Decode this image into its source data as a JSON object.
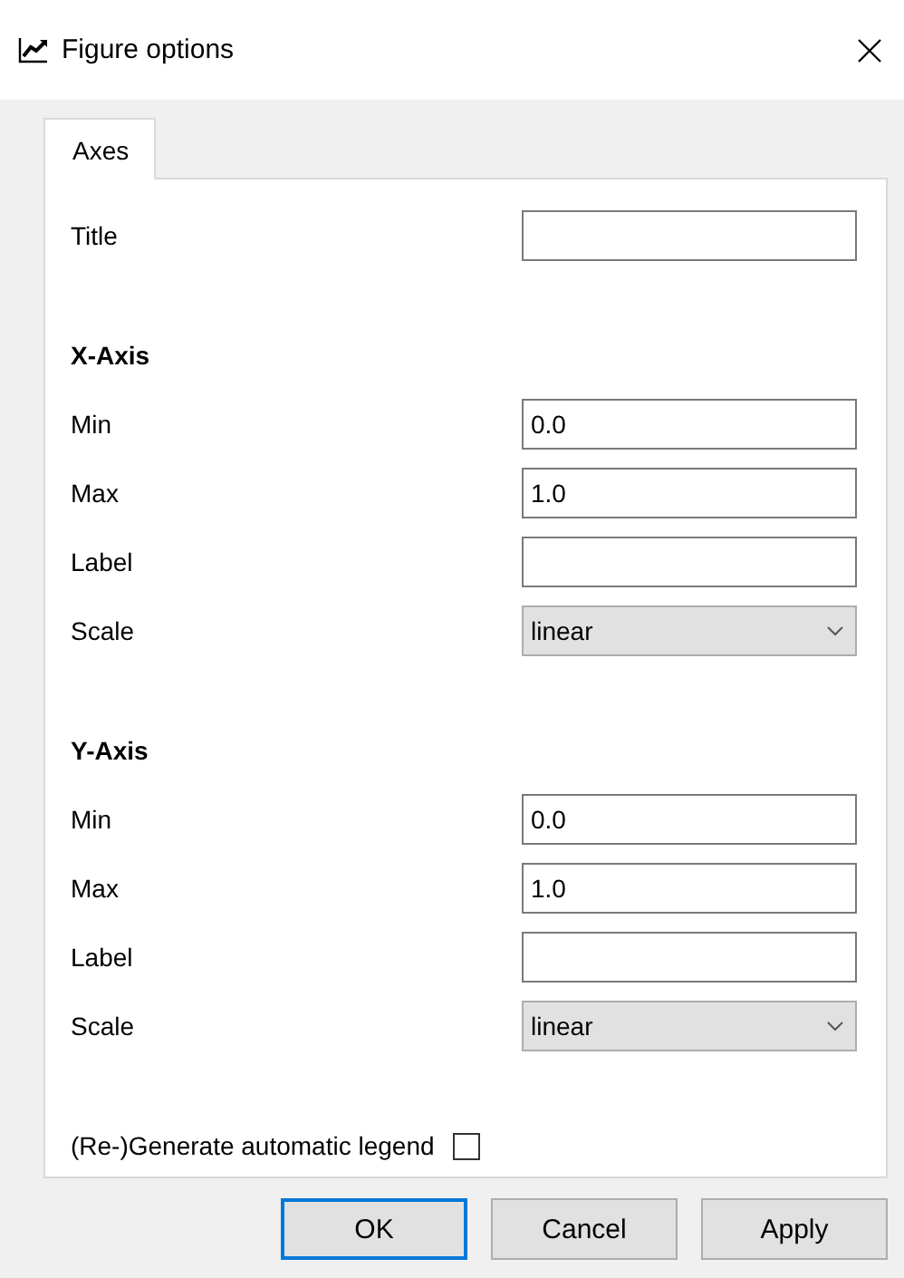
{
  "window": {
    "title": "Figure options"
  },
  "tabs": [
    {
      "label": "Axes",
      "selected": true
    }
  ],
  "rows": [
    {
      "kind": "field",
      "label": "Title"
    },
    {
      "kind": "heading",
      "label": "X-Axis"
    },
    {
      "kind": "field",
      "label": "Min",
      "value": "0.0"
    },
    {
      "kind": "field",
      "label": "Max",
      "value": "1.0"
    },
    {
      "kind": "field",
      "label": "Label"
    },
    {
      "kind": "combo",
      "label": "Scale",
      "value": "linear"
    },
    {
      "kind": "heading",
      "label": "Y-Axis"
    },
    {
      "kind": "field",
      "label": "Min",
      "value": "0.0"
    },
    {
      "kind": "field",
      "label": "Max",
      "value": "1.0"
    },
    {
      "kind": "field",
      "label": "Label"
    },
    {
      "kind": "combo",
      "label": "Scale",
      "value": "linear"
    },
    {
      "kind": "checkbox",
      "label": "(Re-)Generate automatic legend",
      "checked": false
    }
  ],
  "buttons": [
    {
      "label": "OK",
      "default": true
    },
    {
      "label": "Cancel",
      "default": false
    },
    {
      "label": "Apply",
      "default": false
    }
  ]
}
